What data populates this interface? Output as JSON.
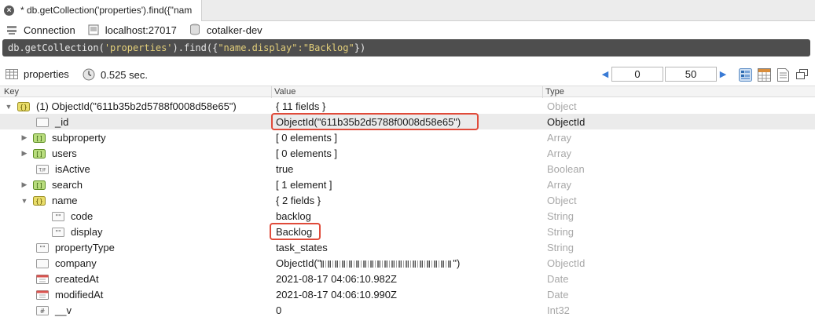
{
  "tab": {
    "title": "* db.getCollection('properties').find({\"nam"
  },
  "connection": {
    "label": "Connection",
    "host": "localhost:27017",
    "database": "cotalker-dev"
  },
  "query": {
    "prefix": "db.getCollection(",
    "collection": "'properties'",
    "mid": ").find({",
    "filter": "\"name.display\":\"Backlog\"",
    "suffix": "})"
  },
  "results": {
    "collection": "properties",
    "time": "0.525 sec.",
    "skip": "0",
    "limit": "50",
    "views": [
      "tree-view-icon",
      "table-view-icon",
      "text-view-icon"
    ]
  },
  "columns": {
    "key": "Key",
    "value": "Value",
    "type": "Type"
  },
  "rows": [
    {
      "key": "(1) ObjectId(\"611b35b2d5788f0008d58e65\")",
      "value": "{ 11 fields }",
      "type": "Object",
      "icon": "object-icon",
      "expand": "open"
    },
    {
      "key": "_id",
      "value": "ObjectId(\"611b35b2d5788f0008d58e65\")",
      "type": "ObjectId",
      "icon": "id-icon"
    },
    {
      "key": "subproperty",
      "value": "[ 0 elements ]",
      "type": "Array",
      "icon": "array-icon",
      "expand": "closed"
    },
    {
      "key": "users",
      "value": "[ 0 elements ]",
      "type": "Array",
      "icon": "array-icon",
      "expand": "closed"
    },
    {
      "key": "isActive",
      "value": "true",
      "type": "Boolean",
      "icon": "boolean-icon"
    },
    {
      "key": "search",
      "value": "[ 1 element ]",
      "type": "Array",
      "icon": "array-icon",
      "expand": "closed"
    },
    {
      "key": "name",
      "value": "{ 2 fields }",
      "type": "Object",
      "icon": "object-icon",
      "expand": "open"
    },
    {
      "key": "code",
      "value": "backlog",
      "type": "String",
      "icon": "string-icon"
    },
    {
      "key": "display",
      "value": "Backlog",
      "type": "String",
      "icon": "string-icon"
    },
    {
      "key": "propertyType",
      "value": "task_states",
      "type": "String",
      "icon": "string-icon"
    },
    {
      "key": "company",
      "value_prefix": "ObjectId(\"",
      "value_suffix": "\")",
      "type": "ObjectId",
      "icon": "id-icon"
    },
    {
      "key": "createdAt",
      "value": "2021-08-17 04:06:10.982Z",
      "type": "Date",
      "icon": "date-icon"
    },
    {
      "key": "modifiedAt",
      "value": "2021-08-17 04:06:10.990Z",
      "type": "Date",
      "icon": "date-icon"
    },
    {
      "key": "__v",
      "value": "0",
      "type": "Int32",
      "icon": "int-icon"
    }
  ],
  "colors": {
    "highlight": "#e04b3a",
    "query_bg": "#4e4e4e",
    "string_literal": "#e3cf7a"
  }
}
